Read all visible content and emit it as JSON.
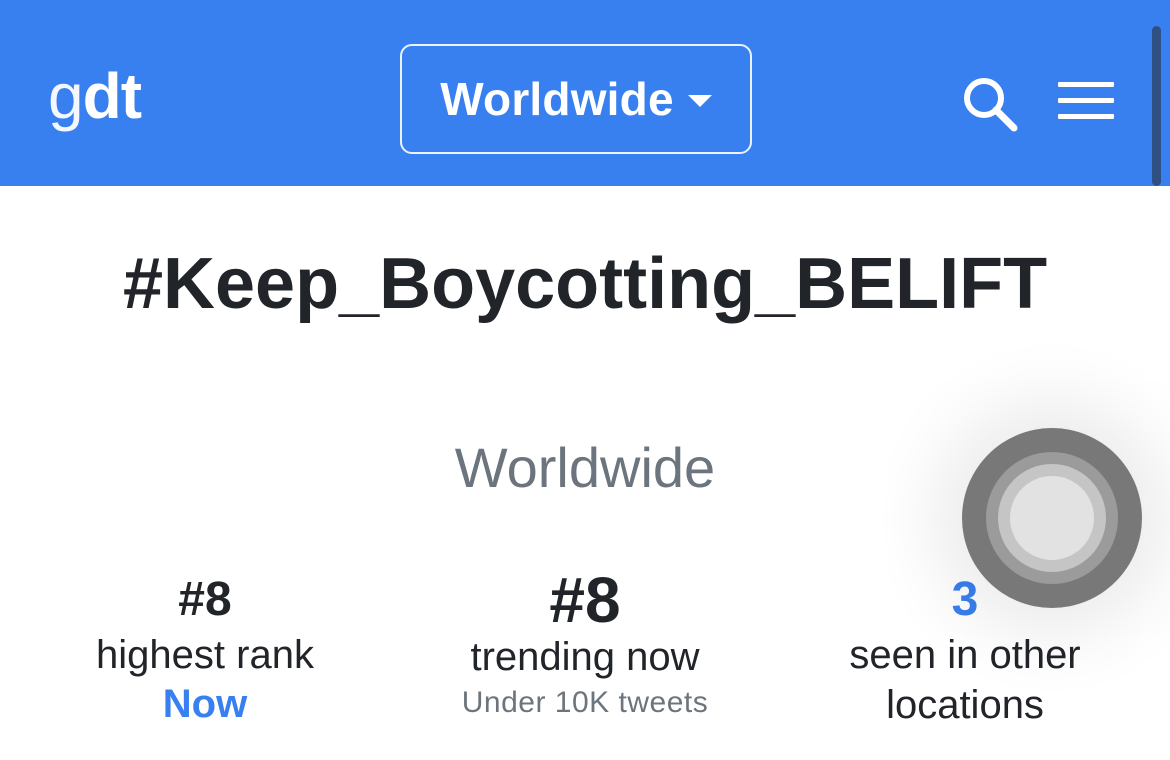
{
  "navbar": {
    "logo_g": "g",
    "logo_dt": "dt",
    "location_dropdown": {
      "selected": "Worldwide"
    },
    "icons": {
      "search": "search-icon",
      "menu": "hamburger-menu-icon"
    }
  },
  "trend": {
    "name": "#Keep_Boycotting_BELIFT",
    "location": "Worldwide"
  },
  "stats": {
    "highest_rank": {
      "value": "#8",
      "label": "highest rank",
      "when": "Now"
    },
    "trending_now": {
      "value": "#8",
      "label": "trending now",
      "volume": "Under 10K tweets"
    },
    "other_locations": {
      "value": "3",
      "label": "seen in other locations"
    }
  },
  "colors": {
    "brand": "#3880f0",
    "text": "#212529",
    "muted": "#6c757d"
  }
}
